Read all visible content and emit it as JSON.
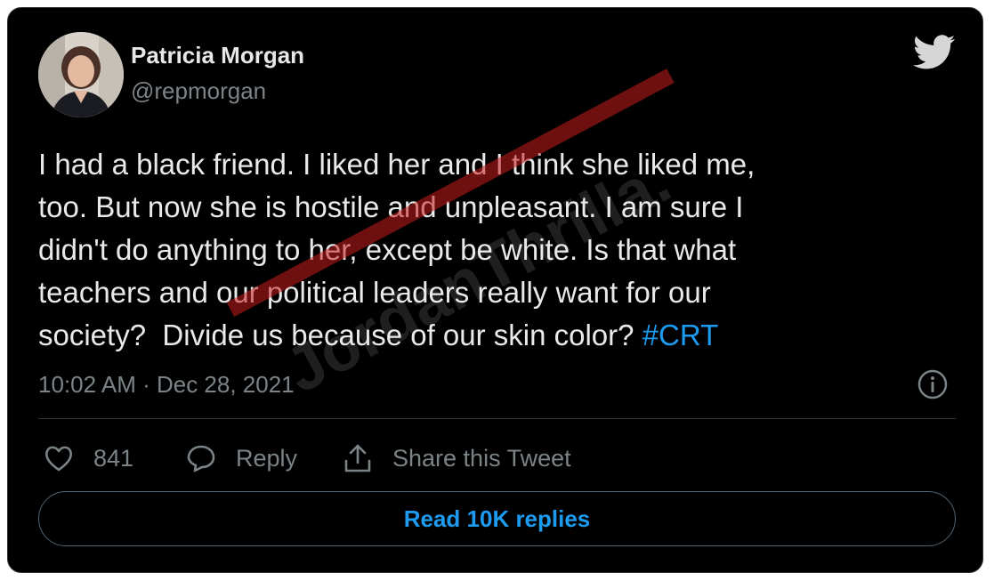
{
  "author": {
    "display_name": "Patricia Morgan",
    "handle": "@repmorgan"
  },
  "tweet": {
    "lines": [
      "I had a black friend. I liked her and I think she liked me,",
      "too. But now she is hostile and unpleasant. I am sure I",
      "didn't do anything to her, except be white. Is that what",
      "teachers and our political leaders really want for our",
      "society?  Divide us because of our skin color? "
    ],
    "hashtag": "#CRT",
    "timestamp": "10:02 AM · Dec 28, 2021"
  },
  "actions": {
    "like_count": "841",
    "reply_label": "Reply",
    "share_label": "Share this Tweet"
  },
  "read_replies_label": "Read 10K replies",
  "watermark": "JordanThrilla.",
  "icons": {
    "brand": "twitter-bird-icon",
    "info": "info-icon",
    "like": "heart-icon",
    "reply": "speech-bubble-icon",
    "share": "share-icon"
  },
  "colors": {
    "background": "#000000",
    "accent": "#1d9bf0",
    "muted": "#7c8387"
  }
}
